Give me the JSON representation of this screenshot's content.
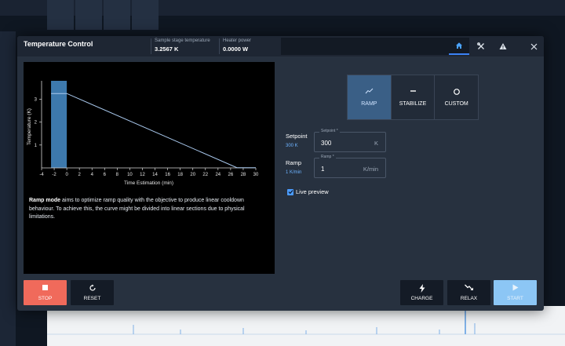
{
  "header": {
    "title": "Temperature Control",
    "sample_stage_label": "Sample stage temperature",
    "sample_stage_value": "3.2567 K",
    "heater_power_label": "Heater power",
    "heater_power_value": "0.0000 W"
  },
  "header_icons": [
    "home-icon",
    "tools-icon",
    "warning-icon",
    "close-icon"
  ],
  "chart_data": {
    "type": "line",
    "xlabel": "Time Estimation (min)",
    "ylabel": "Temperature (K)",
    "xlim": [
      -4,
      30
    ],
    "ylim": [
      0,
      3.6
    ],
    "x_ticks": [
      "-4",
      "-2",
      "0",
      "2",
      "4",
      "6",
      "8",
      "10",
      "12",
      "14",
      "16",
      "18",
      "20",
      "22",
      "24",
      "26",
      "28",
      "30"
    ],
    "y_ticks": [
      "1",
      "2",
      "3"
    ],
    "series": [
      {
        "x": [
          -2.5,
          0,
          27,
          30
        ],
        "y": [
          3.25,
          3.25,
          0.01,
          0.01
        ]
      }
    ],
    "shaded_region": {
      "x_from": -2.5,
      "x_to": 0
    },
    "grid": false
  },
  "description": {
    "bold": "Ramp mode",
    "text": " aims to optimize ramp quality with the objective to produce linear cooldown behaviour. To achieve this, the curve might be divided into linear sections due to physical limitations."
  },
  "modes": [
    {
      "label": "RAMP",
      "icon": "ramp-icon",
      "active": true
    },
    {
      "label": "STABILIZE",
      "icon": "stabilize-icon",
      "active": false
    },
    {
      "label": "CUSTOM",
      "icon": "custom-icon",
      "active": false
    }
  ],
  "setpoint": {
    "label": "Setpoint",
    "sub": "300 K",
    "field_label": "Setpoint *",
    "value": "300",
    "unit": "K"
  },
  "ramp": {
    "label": "Ramp",
    "sub": "1 K/min",
    "field_label": "Ramp *",
    "value": "1",
    "unit": "K/min"
  },
  "live_preview": {
    "label": "Live preview",
    "checked": true
  },
  "actions": {
    "stop": "STOP",
    "reset": "RESET",
    "charge": "CHARGE",
    "relax": "RELAX",
    "start": "START"
  },
  "colors": {
    "accent": "#3b82f6",
    "stop": "#f06a5b",
    "start_disabled": "#8cc6f5",
    "curve": "#a9c9ee",
    "shade": "#3d79ad"
  }
}
